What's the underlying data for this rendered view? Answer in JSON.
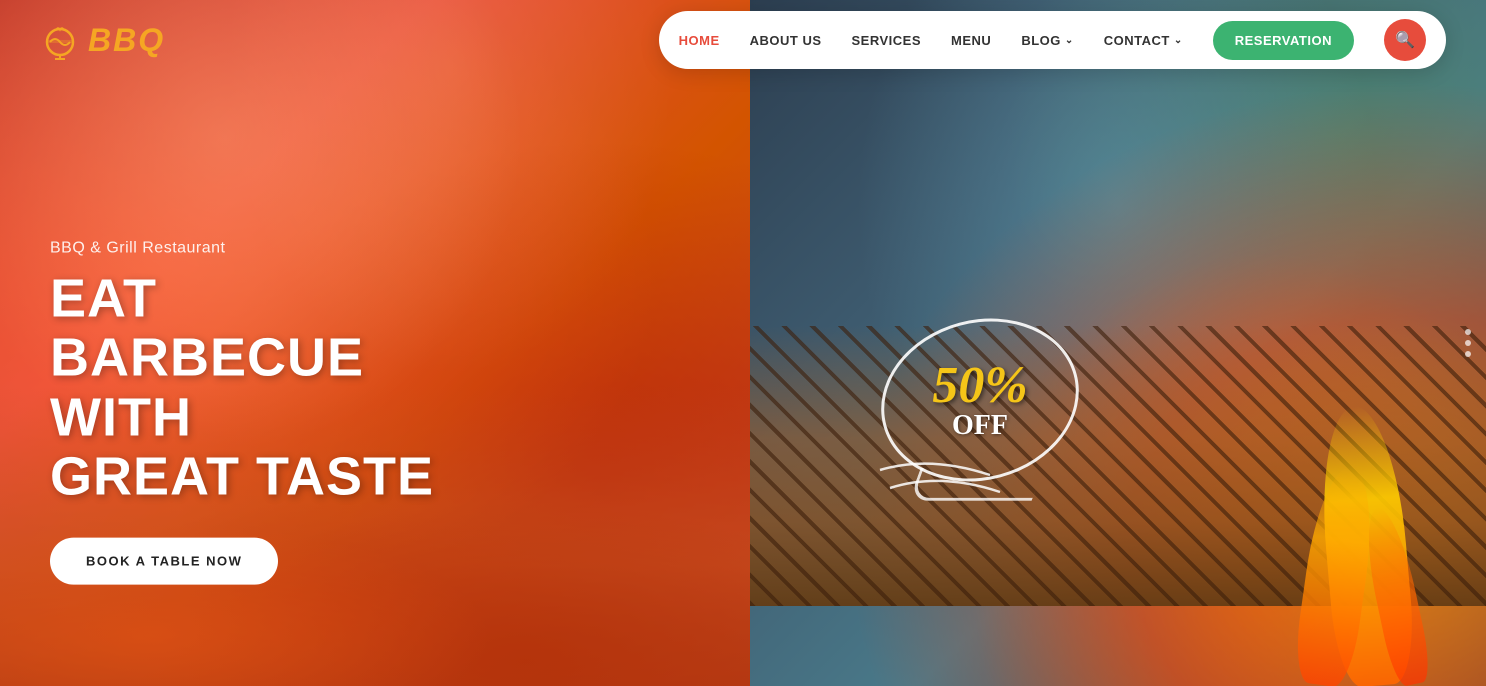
{
  "logo": {
    "text": "BBQ"
  },
  "navbar": {
    "pill": {
      "links": [
        {
          "label": "HOME",
          "state": "active"
        },
        {
          "label": "ABOUT US",
          "state": "inactive"
        },
        {
          "label": "SERVICES",
          "state": "inactive"
        },
        {
          "label": "MENU",
          "state": "inactive"
        },
        {
          "label": "BLOG",
          "state": "inactive",
          "hasArrow": true
        },
        {
          "label": "CONTACT",
          "state": "inactive",
          "hasArrow": true
        }
      ],
      "reservation_label": "RESERVATION",
      "search_aria": "Search"
    }
  },
  "hero": {
    "subtitle": "BBQ & Grill Restaurant",
    "title_line1": "EAT BARBECUE WITH",
    "title_line2": "GREAT TASTE",
    "cta_label": "BOOK A TABLE NOW"
  },
  "discount": {
    "percent": "50%",
    "off": "OFF"
  },
  "colors": {
    "accent_red": "#e74c3c",
    "accent_green": "#3cb371",
    "accent_yellow": "#f5a623",
    "badge_yellow": "#f5c518",
    "nav_bg": "#ffffff"
  }
}
